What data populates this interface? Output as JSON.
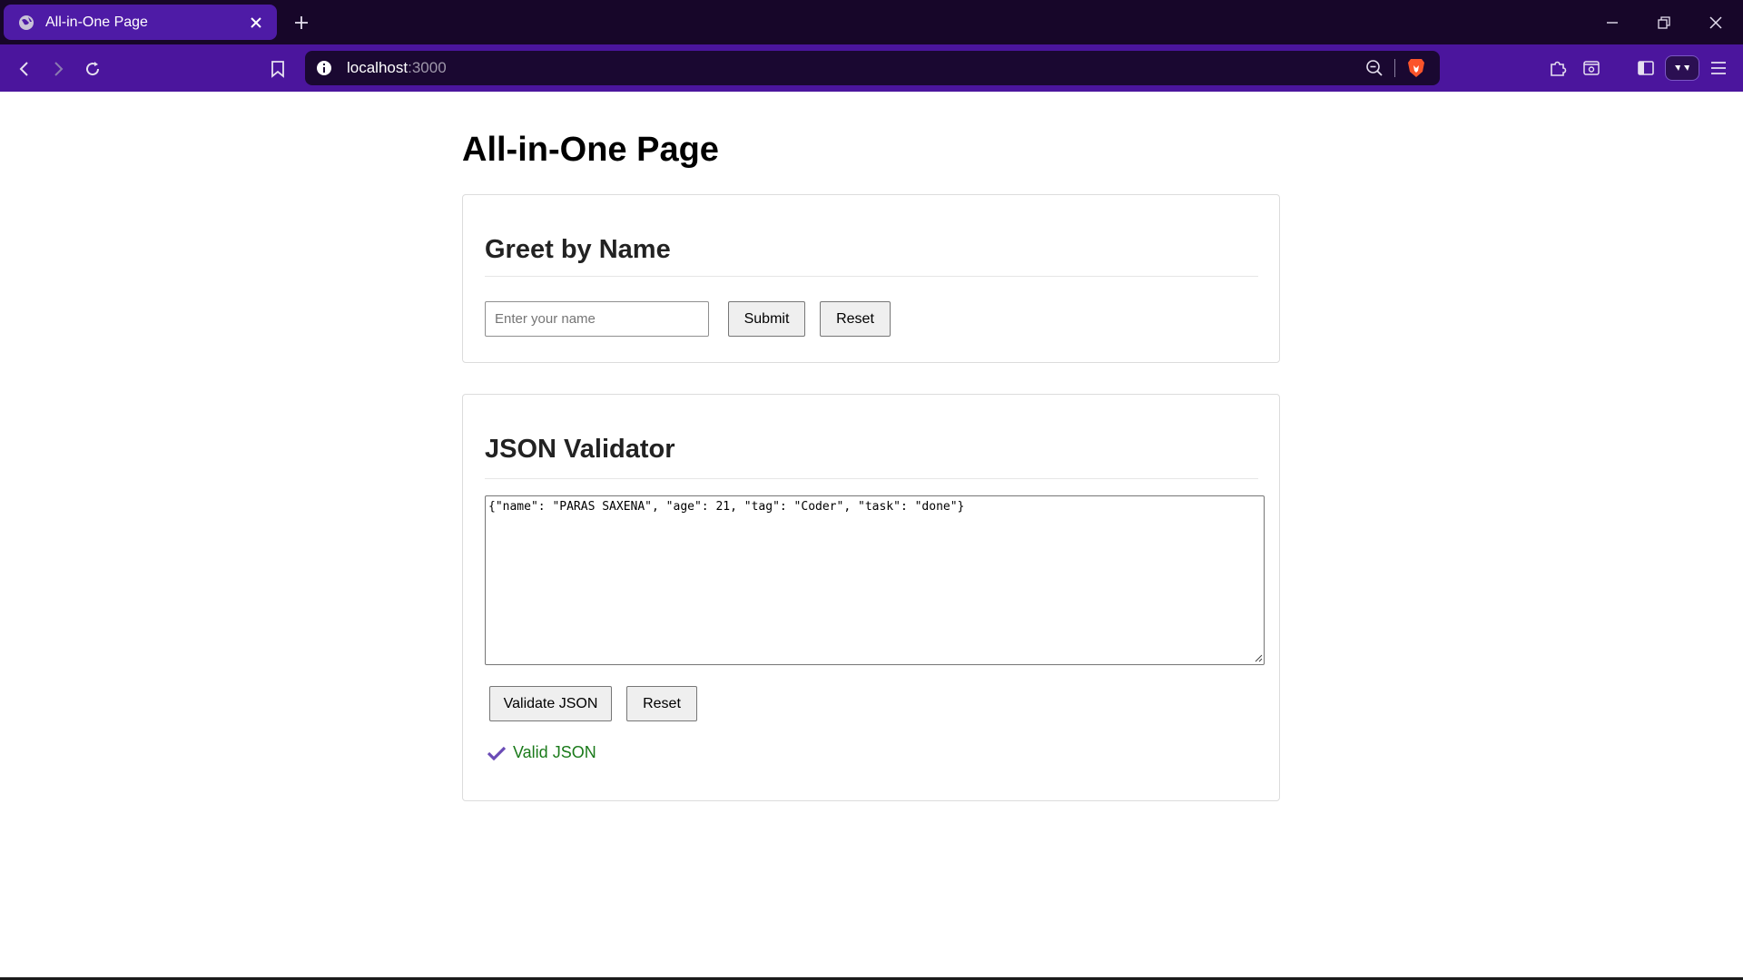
{
  "browser": {
    "tab": {
      "title": "All-in-One Page"
    },
    "address": {
      "host": "localhost",
      "port": ":3000"
    }
  },
  "page": {
    "title": "All-in-One Page",
    "greet": {
      "heading": "Greet by Name",
      "input_placeholder": "Enter your name",
      "input_value": "",
      "submit_label": "Submit",
      "reset_label": "Reset"
    },
    "json_validator": {
      "heading": "JSON Validator",
      "textarea_value": "{\"name\": \"PARAS SAXENA\", \"age\": 21, \"tag\": \"Coder\", \"task\": \"done\"}",
      "validate_label": "Validate JSON",
      "reset_label": "Reset",
      "status_text": "Valid JSON",
      "status_icon": "checkmark-icon"
    }
  },
  "colors": {
    "tabbar_bg": "#170629",
    "navbar_bg": "#4b159d",
    "active_tab_bg": "#4e1ba6",
    "valid_text": "#1a7a1a",
    "checkmark": "#6a4bb6"
  }
}
